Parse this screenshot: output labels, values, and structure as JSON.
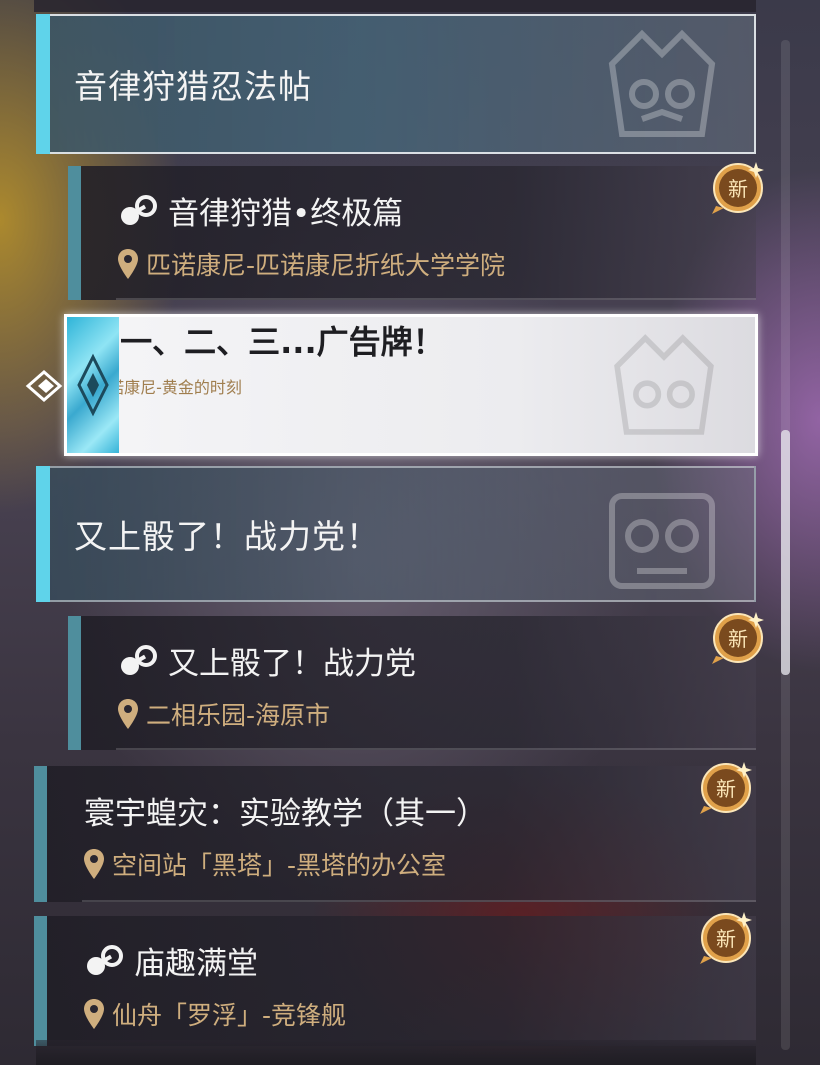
{
  "categories": [
    {
      "title": "音律狩猎忍法帖"
    },
    {
      "title": "又上骰了！战力党！"
    }
  ],
  "quests": [
    {
      "name": "音律狩猎•终极篇",
      "location": "匹诺康尼-匹诺康尼折纸大学学院",
      "badge": "新"
    },
    {
      "name": "一、二、三...广告牌！",
      "location": "匹诺康尼-黄金的时刻"
    },
    {
      "name": "又上骰了！战力党",
      "location": "二相乐园-海原市",
      "badge": "新"
    },
    {
      "name": "寰宇蝗灾：实验教学（其一）",
      "location": "空间站「黑塔」-黑塔的办公室",
      "badge": "新"
    },
    {
      "name": "庙趣满堂",
      "location": "仙舟「罗浮」-竞锋舰",
      "badge": "新"
    }
  ],
  "colors": {
    "accent_cyan": "#5fd3ea",
    "location_gold": "#cfae7e",
    "badge_gold": "#e0a14a"
  },
  "icons": {
    "quest_type": "quest-type-icon",
    "location": "location-pin-icon",
    "selection": "selection-pointer-icon",
    "new": "new-badge-icon"
  }
}
